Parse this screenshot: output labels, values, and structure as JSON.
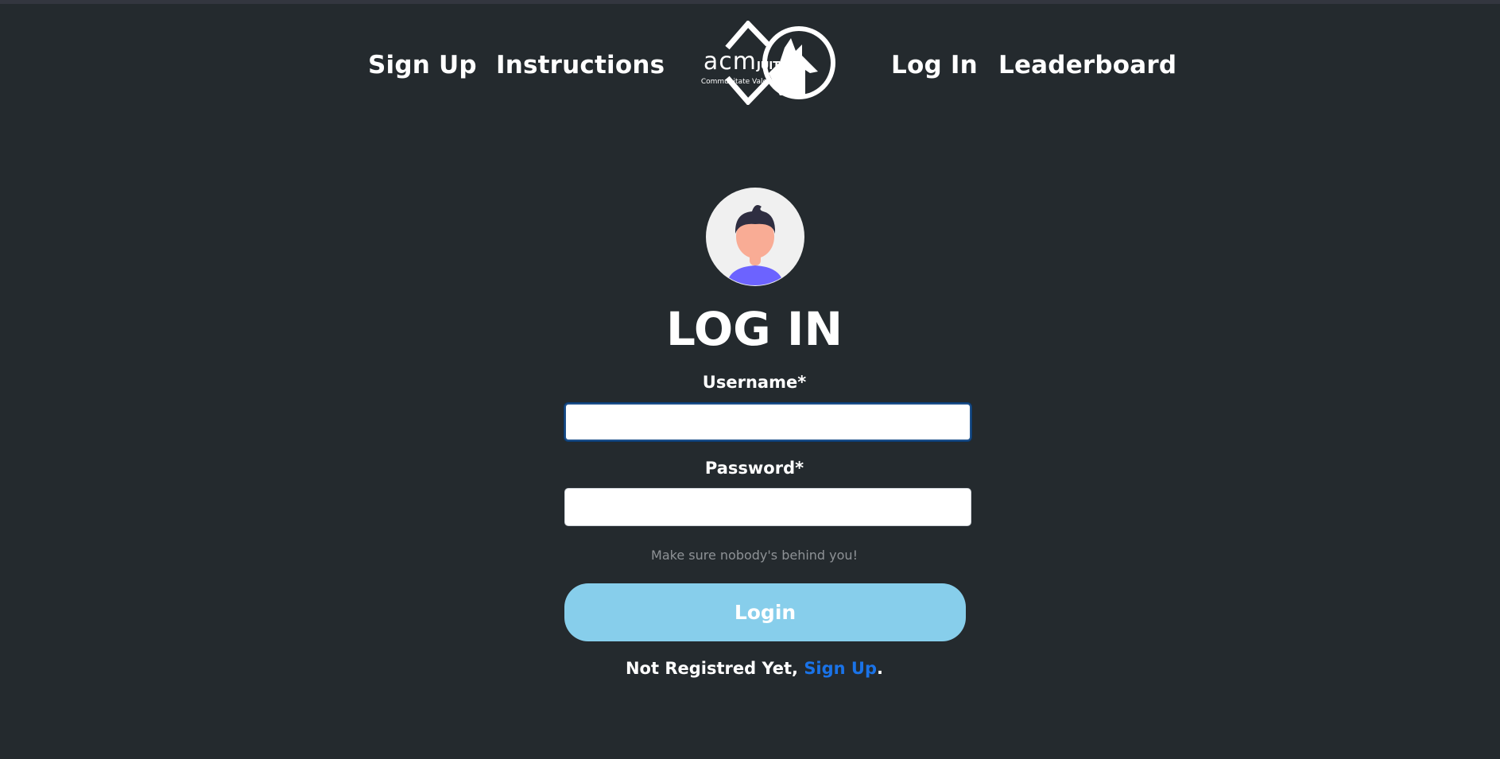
{
  "nav": {
    "signup": "Sign Up",
    "instructions": "Instructions",
    "login": "Log In",
    "leaderboard": "Leaderboard",
    "logo_acm": "acm",
    "logo_juit": "JUIT",
    "logo_motto": "Communitate Valemus"
  },
  "form": {
    "title": "LOG IN",
    "username_label": "Username*",
    "username_value": "",
    "password_label": "Password*",
    "password_value": "",
    "hint": "Make sure nobody's behind you!",
    "login_button": "Login",
    "register_prefix": "Not Registred Yet, ",
    "register_link": "Sign Up",
    "register_suffix": "."
  },
  "icons": {
    "logo": "acm-juit-wolf-logo",
    "avatar": "user-avatar-icon"
  },
  "colors": {
    "background": "#242a2e",
    "button": "#87ceeb",
    "link": "#1a73e8",
    "hint": "#8e9296"
  }
}
